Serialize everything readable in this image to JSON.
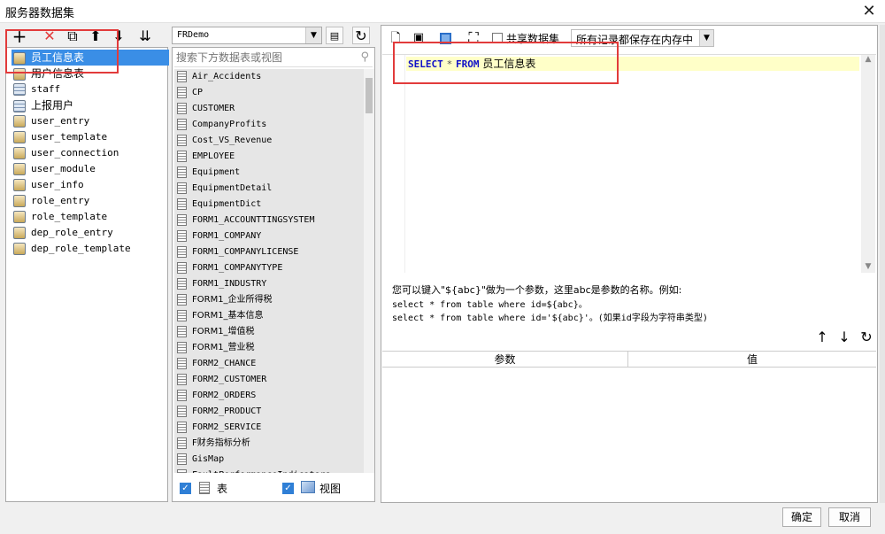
{
  "window": {
    "title": "服务器数据集",
    "close_glyph": "✕"
  },
  "left_toolbar": {
    "add": "+",
    "delete": "✕",
    "copy": "⧉",
    "move_up": "⬆",
    "move_down": "⬇",
    "sort": "⇊"
  },
  "datasets": [
    {
      "label": "员工信息表",
      "selected": true,
      "kind": "sql"
    },
    {
      "label": "用户信息表",
      "kind": "sql"
    },
    {
      "label": "staff",
      "kind": "table"
    },
    {
      "label": "上报用户",
      "kind": "table"
    },
    {
      "label": "user_entry",
      "kind": "sql"
    },
    {
      "label": "user_template",
      "kind": "sql"
    },
    {
      "label": "user_connection",
      "kind": "sql"
    },
    {
      "label": "user_module",
      "kind": "sql"
    },
    {
      "label": "user_info",
      "kind": "sql"
    },
    {
      "label": "role_entry",
      "kind": "sql"
    },
    {
      "label": "role_template",
      "kind": "sql"
    },
    {
      "label": "dep_role_entry",
      "kind": "sql"
    },
    {
      "label": "dep_role_template",
      "kind": "sql"
    }
  ],
  "middle": {
    "connection": "FRDemo",
    "search_placeholder": "搜索下方数据表或视图",
    "tables": [
      "Air_Accidents",
      "CP",
      "CUSTOMER",
      "CompanyProfits",
      "Cost_VS_Revenue",
      "EMPLOYEE",
      "Equipment",
      "EquipmentDetail",
      "EquipmentDict",
      "FORM1_ACCOUNTTINGSYSTEM",
      "FORM1_COMPANY",
      "FORM1_COMPANYLICENSE",
      "FORM1_COMPANYTYPE",
      "FORM1_INDUSTRY",
      "FORM1_企业所得税",
      "FORM1_基本信息",
      "FORM1_增值税",
      "FORM1_营业税",
      "FORM2_CHANCE",
      "FORM2_CUSTOMER",
      "FORM2_ORDERS",
      "FORM2_PRODUCT",
      "FORM2_SERVICE",
      "F财务指标分析",
      "GisMap",
      "FaultPerformanceIndicators"
    ],
    "filter_table_label": "表",
    "filter_view_label": "视图"
  },
  "editor": {
    "share_dataset_label": "共享数据集",
    "memory_option": "所有记录都保存在内存中",
    "sql_kw1": "SELECT",
    "sql_star": "*",
    "sql_kw2": "FROM",
    "sql_table": "员工信息表",
    "hint_line1": "您可以键入\"${abc}\"做为一个参数，这里abc是参数的名称。例如:",
    "hint_line2": "select * from table where id=${abc}。",
    "hint_line3": "select * from table where id='${abc}'。(如果id字段为字符串类型)",
    "param_col": "参数",
    "value_col": "值"
  },
  "footer": {
    "ok": "确定",
    "cancel": "取消"
  },
  "colors": {
    "selection": "#3a8ee6",
    "highlight_line": "#ffffc8",
    "keyword": "#1010c8",
    "annotation": "#e23b3b"
  }
}
